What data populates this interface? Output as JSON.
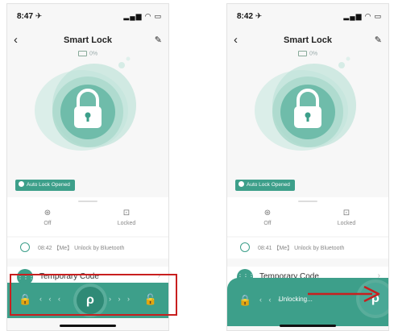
{
  "screens": [
    {
      "status_time": "8:47 ✈",
      "nav_title": "Smart Lock",
      "battery": "0%",
      "auto_lock": "Auto Lock Opened",
      "mode_off": "Off",
      "mode_locked": "Locked",
      "log_text": "08:42 【Me】 Unlock by Bluetooth",
      "temp_code": "Temporary Code"
    },
    {
      "status_time": "8:42 ✈",
      "nav_title": "Smart Lock",
      "battery": "0%",
      "auto_lock": "Auto Lock Opened",
      "mode_off": "Off",
      "mode_locked": "Locked",
      "log_text": "08:41 【Me】 Unlock by Bluetooth",
      "temp_code": "Temporary Code",
      "slider_text": "Unlocking..."
    }
  ],
  "icons": {
    "back": "‹",
    "edit": "✎",
    "lock": "🔒",
    "unlock": "🔓",
    "key": "ρ",
    "keypad": "⋮⋮⋮",
    "chevron": "›",
    "arrows_left": "‹ ‹ ‹",
    "arrows_right": "› › ›",
    "mode_off": "⊛",
    "mode_locked": "⊡"
  },
  "colors": {
    "accent": "#3d9f8a",
    "highlight": "#c81f1f"
  }
}
